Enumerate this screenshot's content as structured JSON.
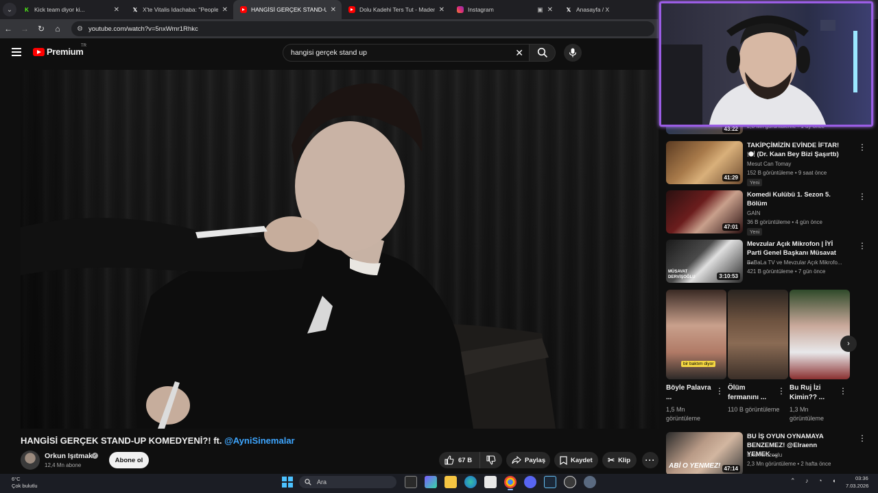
{
  "browser": {
    "tabs": [
      {
        "title": "Kick team diyor ki...",
        "favicon": "kick-icon",
        "color": "#53fc18",
        "active": false
      },
      {
        "title": "X'te Vitalis Idachaba: \"People in",
        "favicon": "x-icon",
        "color": "#ffffff",
        "active": false
      },
      {
        "title": "HANGİSİ GERÇEK STAND-UP KO",
        "favicon": "youtube-icon",
        "color": "#ff0000",
        "active": true
      },
      {
        "title": "Dolu Kadehi Ters Tut - Madem",
        "favicon": "youtube-icon",
        "color": "#ff0000",
        "active": false
      },
      {
        "title": "Instagram",
        "favicon": "instagram-icon",
        "color": "#e1306c",
        "active": false
      },
      {
        "title": "Anasayfa / X",
        "favicon": "x-icon",
        "color": "#ffffff",
        "active": false
      }
    ],
    "url": "youtube.com/watch?v=5nxWmr1Rhkc"
  },
  "youtube": {
    "logo_text": "Premium",
    "region": "TR",
    "search_query": "hangisi gerçek stand up"
  },
  "video": {
    "title": "HANGİSİ GERÇEK STAND-UP KOMEDYENİ?! ft. ",
    "mention": "@AyniSinemalar",
    "channel": "Orkun Işıtmak",
    "subscribers": "12,4 Mn abone",
    "subscribe_label": "Abone ol",
    "likes": "67 B",
    "share_label": "Paylaş",
    "save_label": "Kaydet",
    "clip_label": "Klip"
  },
  "sidebar": {
    "partial_item": {
      "duration": "43:22",
      "meta": "2,8 Mn görüntüleme • 1 ay önce"
    },
    "items": [
      {
        "title": "TAKİPÇİMİZİN EVİNDE İFTAR! 🍽️ (Dr. Kaan Bey Bizi Şaşırttı)",
        "channel": "Mesut Can Tomay",
        "meta": "152 B görüntüleme • 9 saat önce",
        "badge": "Yeni",
        "duration": "41:29"
      },
      {
        "title": "Komedi Kulübü 1. Sezon 5. Bölüm",
        "channel": "GAİN",
        "meta": "36 B görüntüleme • 4 gün önce",
        "badge": "Yeni",
        "duration": "47:01"
      },
      {
        "title": "Mevzular Açık Mikrofon | İYİ Parti Genel Başkanı Müsavat ...",
        "channel": "BaBaLa TV ve Mevzular Açık Mikrofo...",
        "meta": "421 B görüntüleme • 7 gün önce",
        "badge": "",
        "duration": "3:10:53"
      },
      {
        "title": "BU İŞ OYUN OYNAMAYA BENZEMEZ! @Elraenn YEMEK ...",
        "channel": "Enis Kirazoglu",
        "meta": "2,3 Mn görüntüleme • 2 hafta önce",
        "badge": "",
        "duration": "47:14"
      }
    ],
    "shorts": [
      {
        "title": "Böyle Palavra ...",
        "views": "1,5 Mn görüntüleme",
        "caption": "bir baktım diyor"
      },
      {
        "title": "Ölüm fermanını ...",
        "views": "110 B görüntüleme",
        "caption": ""
      },
      {
        "title": "Bu Ruj İzi Kimin?? ...",
        "views": "1,3 Mn görüntüleme",
        "caption": ""
      }
    ],
    "thumb_text_3": "MÜSAVAT DERVİŞOĞLU",
    "thumb_text_4": "ABİ O YENMEZ!"
  },
  "taskbar": {
    "temperature": "6°C",
    "weather": "Çok bulutlu",
    "search_label": "Ara",
    "time": "03:36",
    "date": "7.03.2026"
  }
}
